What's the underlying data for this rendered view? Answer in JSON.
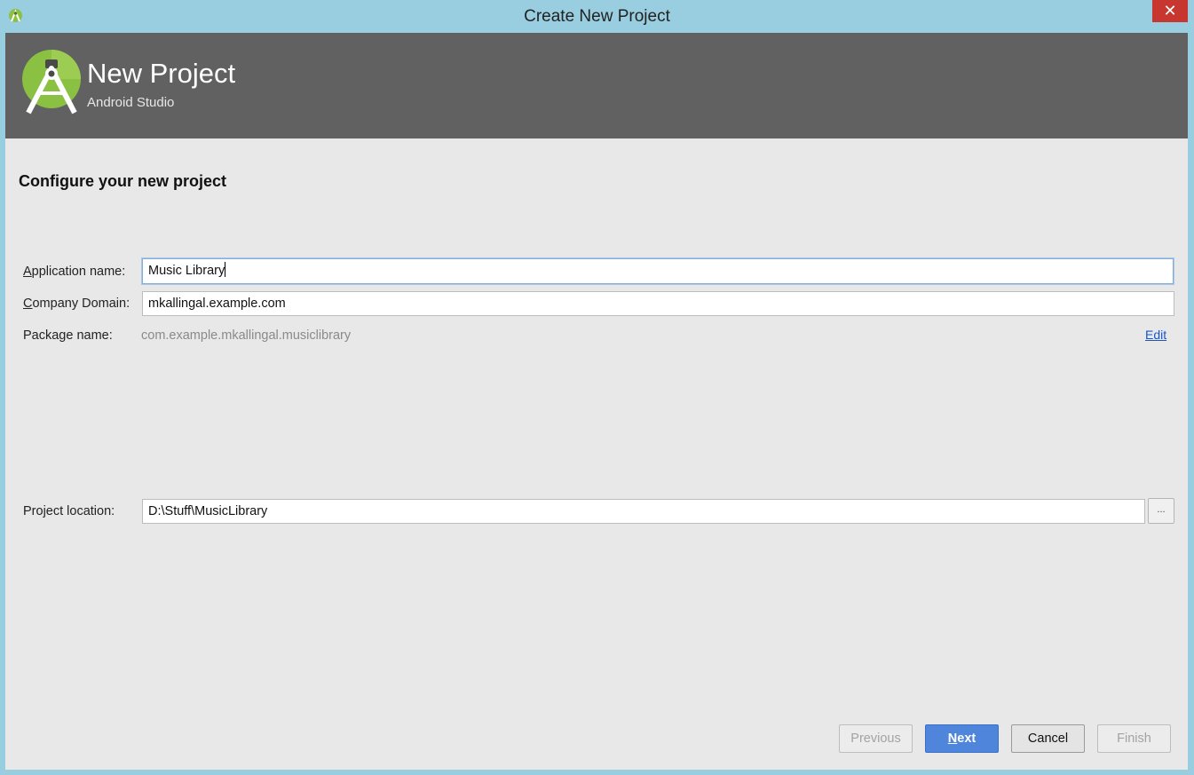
{
  "window": {
    "title": "Create New Project",
    "close_glyph": "✕"
  },
  "banner": {
    "title": "New Project",
    "subtitle": "Android Studio",
    "logo_icon": "android-studio-logo-icon"
  },
  "section_title": "Configure your new project",
  "form": {
    "app_name": {
      "label_first": "A",
      "label_rest": "pplication name:",
      "value": "Music Library"
    },
    "company_domain": {
      "label_first": "C",
      "label_rest": "ompany Domain:",
      "value": "mkallingal.example.com"
    },
    "package_name": {
      "label": "Package name:",
      "value": "com.example.mkallingal.musiclibrary",
      "edit_label": "Edit"
    },
    "project_location": {
      "label": "Project location:",
      "value": "D:\\Stuff\\MusicLibrary",
      "browse_label": "..."
    }
  },
  "buttons": {
    "previous": "Previous",
    "next_first": "N",
    "next_rest": "ext",
    "cancel": "Cancel",
    "finish": "Finish"
  },
  "colors": {
    "titlebar": "#99cde0",
    "banner": "#616161",
    "accent": "#4f86dc",
    "close": "#c7372f",
    "logo_green": "#8ac143"
  }
}
